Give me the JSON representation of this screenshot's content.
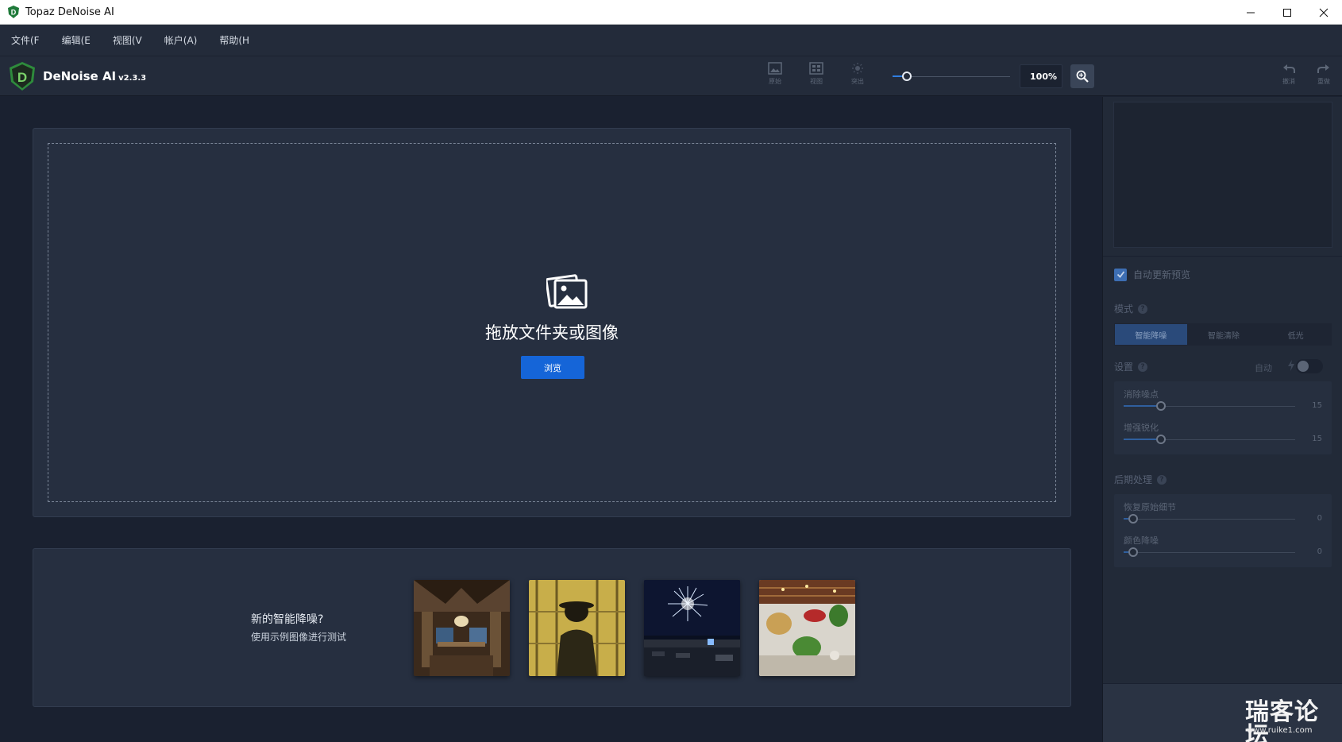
{
  "window": {
    "title": "Topaz DeNoise AI"
  },
  "menu": [
    {
      "label": "文件(F"
    },
    {
      "label": "编辑(E"
    },
    {
      "label": "视图(V"
    },
    {
      "label": "帐户(A)"
    },
    {
      "label": "帮助(H"
    }
  ],
  "toolbar": {
    "brand_name": "DeNoise AI",
    "version": "v2.3.3",
    "tools": [
      {
        "label": "原始",
        "icon": "image-icon"
      },
      {
        "label": "视图",
        "icon": "grid-view-icon"
      },
      {
        "label": "突出",
        "icon": "sun-icon"
      }
    ],
    "zoom_level": 0.12,
    "zoom_text": "100%",
    "undo_label": "撤消",
    "redo_label": "重做"
  },
  "main": {
    "drop_text": "拖放文件夹或图像",
    "browse_label": "浏览",
    "samples_title": "新的智能降噪?",
    "samples_subtitle": "使用示例图像进行测试"
  },
  "sidebar": {
    "auto_update_label": "自动更新预览",
    "auto_update_checked": true,
    "mode_label": "模式",
    "modes": [
      {
        "label": "智能降噪",
        "active": true
      },
      {
        "label": "智能清除",
        "active": false
      },
      {
        "label": "低光",
        "active": false
      }
    ],
    "settings_label": "设置",
    "auto_label": "自动",
    "sliders": [
      {
        "label": "消除噪点",
        "value": "15",
        "fraction": 0.17
      },
      {
        "label": "增强锐化",
        "value": "15",
        "fraction": 0.17
      }
    ],
    "post_label": "后期处理",
    "post_sliders": [
      {
        "label": "恢复原始细节",
        "value": "0",
        "fraction": 0.0
      },
      {
        "label": "颜色降噪",
        "value": "0",
        "fraction": 0.0
      }
    ]
  },
  "watermark": {
    "text": "瑞客论坛",
    "sub": "www.ruike1.com"
  },
  "colors": {
    "accent": "#1565d8",
    "background": "#1a2130",
    "panel": "#262f40"
  }
}
